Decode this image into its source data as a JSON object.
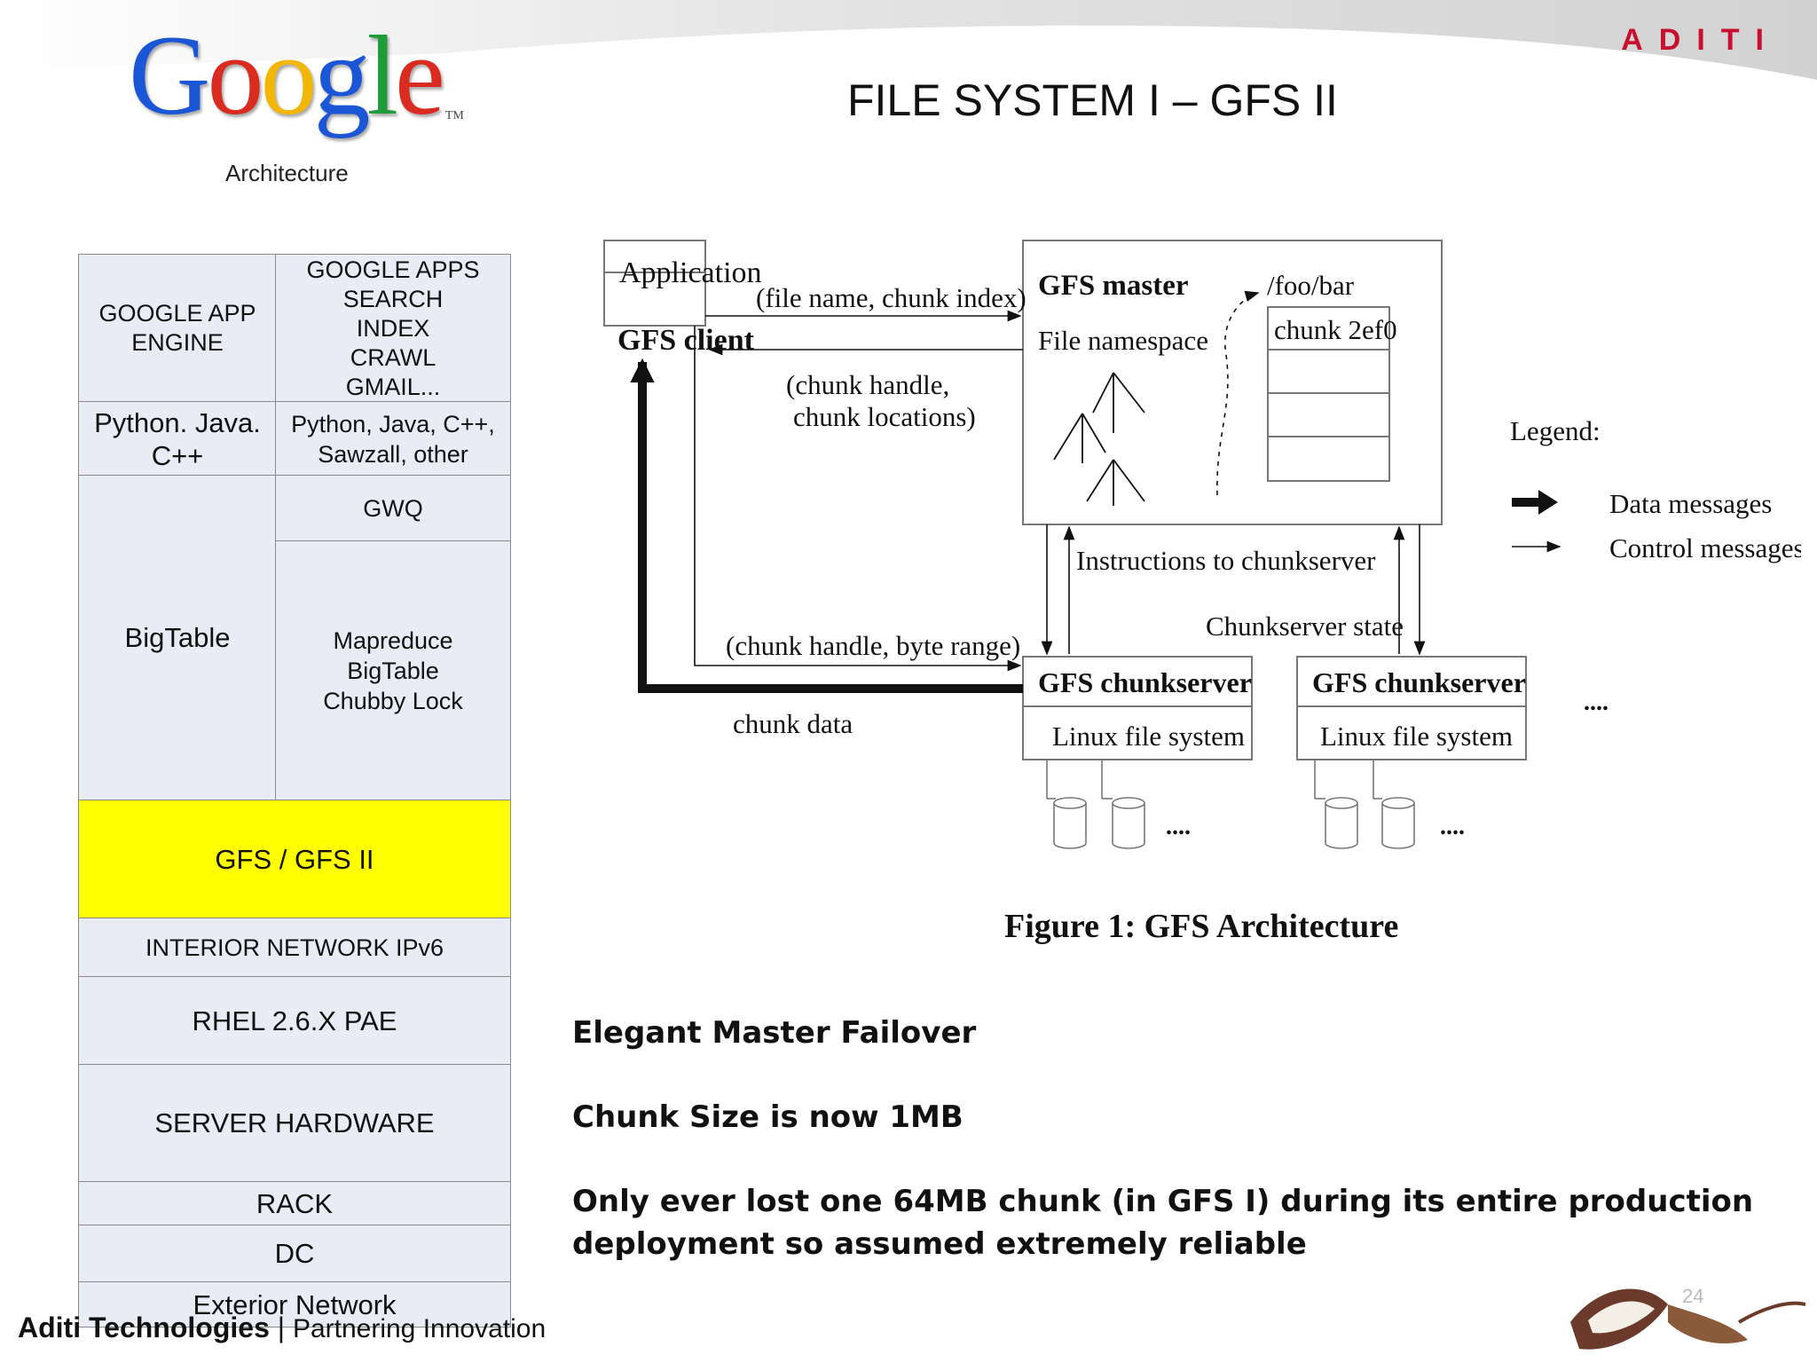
{
  "header": {
    "logo_text": [
      "G",
      "o",
      "o",
      "g",
      "l",
      "e"
    ],
    "logo_tm": "TM",
    "logo_subtitle": "Architecture",
    "title": "FILE SYSTEM I – GFS II",
    "brand_logo": "ADITI"
  },
  "stack": {
    "app_engine": [
      "GOOGLE APP",
      "ENGINE"
    ],
    "apps": [
      "GOOGLE APPS",
      "SEARCH",
      "INDEX",
      "CRAWL",
      "GMAIL..."
    ],
    "langs_left": [
      "Python. Java.",
      "C++"
    ],
    "langs_right": [
      "Python, Java, C++,",
      "Sawzall, other"
    ],
    "bigtable": "BigTable",
    "gwq": "GWQ",
    "services": [
      "Mapreduce",
      "BigTable",
      "Chubby Lock"
    ],
    "gfs": "GFS / GFS II",
    "network": "INTERIOR NETWORK IPv6",
    "rhel": "RHEL 2.6.X PAE",
    "hardware": "SERVER HARDWARE",
    "rack": "RACK",
    "dc": "DC",
    "exterior": "Exterior Network"
  },
  "diagram": {
    "application": "Application",
    "gfs_client": "GFS client",
    "file_name_chunk_index": "(file name, chunk index)",
    "chunk_handle_locations_1": "(chunk handle,",
    "chunk_handle_locations_2": "chunk locations)",
    "gfs_master": "GFS master",
    "file_namespace": "File namespace",
    "foo_bar": "/foo/bar",
    "chunk_2ef0": "chunk 2ef0",
    "instructions": "Instructions to chunkserver",
    "chunkserver_state": "Chunkserver state",
    "chunk_handle_byte_range": "(chunk handle, byte range)",
    "chunk_data": "chunk data",
    "chunkserver": "GFS chunkserver",
    "linux_fs": "Linux file system",
    "ellipsis": "....",
    "legend_title": "Legend:",
    "legend_data": "Data messages",
    "legend_control": "Control messages",
    "caption": "Figure 1: GFS Architecture"
  },
  "bullets": [
    "Elegant Master Failover",
    "Chunk Size is now 1MB",
    "Only ever lost one 64MB chunk (in GFS I) during its entire production deployment so assumed extremely reliable"
  ],
  "footer": {
    "brand": "Aditi Technologies",
    "separator": "|",
    "tagline": "Partnering Innovation",
    "page_number": "24"
  },
  "colors": {
    "gfs_highlight": "#ffff00",
    "table_bg": "#e9ecf5",
    "aditi_red": "#c8102e"
  }
}
